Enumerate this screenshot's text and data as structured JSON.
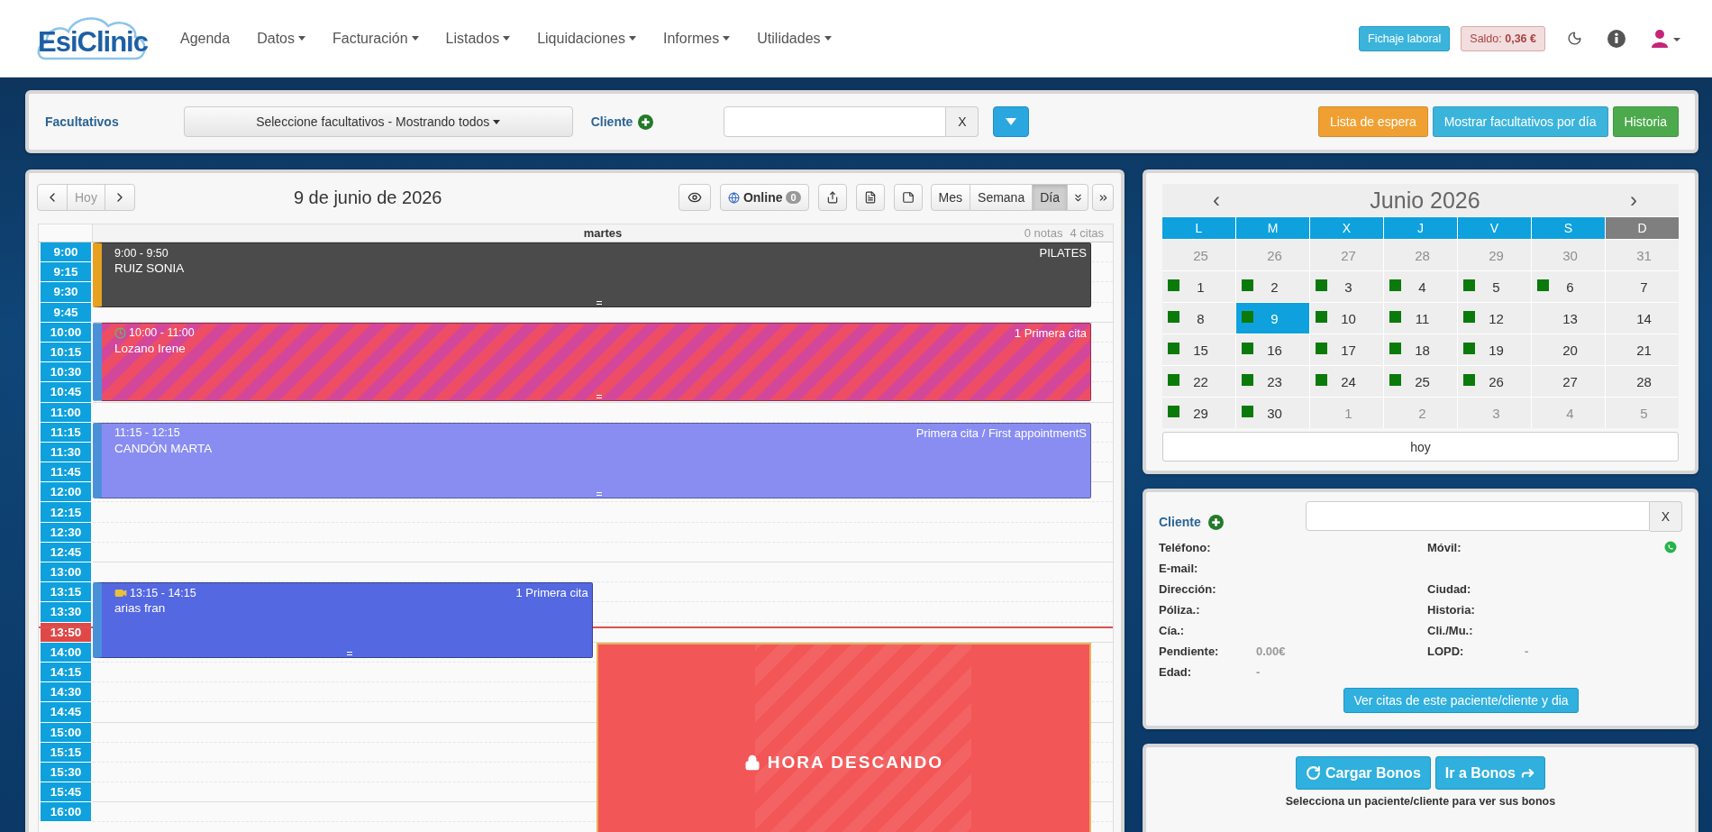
{
  "header": {
    "logo": "EsiClinic",
    "nav": [
      {
        "label": "Agenda",
        "has_menu": false
      },
      {
        "label": "Datos",
        "has_menu": true
      },
      {
        "label": "Facturación",
        "has_menu": true
      },
      {
        "label": "Listados",
        "has_menu": true
      },
      {
        "label": "Liquidaciones",
        "has_menu": true
      },
      {
        "label": "Informes",
        "has_menu": true
      },
      {
        "label": "Utilidades",
        "has_menu": true
      }
    ],
    "clock_in_button": "Fichaje laboral",
    "balance": {
      "label": "Saldo:",
      "amount": "0,36 €"
    }
  },
  "toolbar": {
    "practitioners_label": "Facultativos",
    "practitioners_select": "Seleccione facultativos - Mostrando todos",
    "client_label": "Cliente",
    "clear_button": "X",
    "buttons": [
      {
        "label": "Lista de espera",
        "color": "#f0a032"
      },
      {
        "label": "Mostrar facultativos por día",
        "color": "#3bb4dc"
      },
      {
        "label": "Historia",
        "color": "#4caa4c"
      }
    ]
  },
  "agenda": {
    "today_button": {
      "label": "Hoy",
      "disabled": true
    },
    "date_title": "9 de junio de 2026",
    "online": {
      "label": "Online",
      "count": "0"
    },
    "views": [
      {
        "label": "Mes",
        "selected": false
      },
      {
        "label": "Semana",
        "selected": false
      },
      {
        "label": "Día",
        "selected": true
      }
    ],
    "day_name": "martes",
    "notes": "0 notas",
    "appointments_count": "4 citas",
    "times": [
      {
        "label": "9:00",
        "current": false
      },
      {
        "label": "9:15",
        "current": false
      },
      {
        "label": "9:30",
        "current": false
      },
      {
        "label": "9:45",
        "current": false
      },
      {
        "label": "10:00",
        "current": false
      },
      {
        "label": "10:15",
        "current": false
      },
      {
        "label": "10:30",
        "current": false
      },
      {
        "label": "10:45",
        "current": false
      },
      {
        "label": "11:00",
        "current": false
      },
      {
        "label": "11:15",
        "current": false
      },
      {
        "label": "11:30",
        "current": false
      },
      {
        "label": "11:45",
        "current": false
      },
      {
        "label": "12:00",
        "current": false
      },
      {
        "label": "12:15",
        "current": false
      },
      {
        "label": "12:30",
        "current": false
      },
      {
        "label": "12:45",
        "current": false
      },
      {
        "label": "13:00",
        "current": false
      },
      {
        "label": "13:15",
        "current": false
      },
      {
        "label": "13:30",
        "current": false
      },
      {
        "label": "13:50",
        "current": true
      },
      {
        "label": "14:00",
        "current": false
      },
      {
        "label": "14:15",
        "current": false
      },
      {
        "label": "14:30",
        "current": false
      },
      {
        "label": "14:45",
        "current": false
      },
      {
        "label": "15:00",
        "current": false
      },
      {
        "label": "15:15",
        "current": false
      },
      {
        "label": "15:30",
        "current": false
      },
      {
        "label": "15:45",
        "current": false
      },
      {
        "label": "16:00",
        "current": false
      }
    ],
    "events": [
      {
        "kind": "plain",
        "time": "9:00 - 9:50",
        "name": "RUIZ SONIA",
        "tag": "PILATES",
        "color": "#4b4b4b"
      },
      {
        "kind": "striped",
        "time": "10:00 - 11:00",
        "name": "Lozano Irene",
        "tag": "1 Primera cita",
        "color": "#ee4d66"
      },
      {
        "kind": "plain",
        "time": "11:15 - 12:15",
        "name": "CANDÓN MARTA",
        "tag": "Primera cita / First appointmentS",
        "color": "#898df2"
      },
      {
        "kind": "plain",
        "time": "13:15 - 14:15",
        "name": "arias fran",
        "tag": "1 Primera cita",
        "color": "#5468e2"
      },
      {
        "kind": "blocked",
        "title": "HORA DESCANDO",
        "color": "#f35656"
      }
    ]
  },
  "mini_calendar": {
    "title": "Junio 2026",
    "prev": "‹",
    "next": "›",
    "weekdays": [
      {
        "label": "L",
        "closed": false
      },
      {
        "label": "M",
        "closed": false
      },
      {
        "label": "X",
        "closed": false
      },
      {
        "label": "J",
        "closed": false
      },
      {
        "label": "V",
        "closed": false
      },
      {
        "label": "S",
        "closed": false
      },
      {
        "label": "D",
        "closed": true
      }
    ],
    "weeks": [
      [
        {
          "day": "25",
          "other_month": true,
          "has_appointments": false,
          "selected": false
        },
        {
          "day": "26",
          "other_month": true,
          "has_appointments": false,
          "selected": false
        },
        {
          "day": "27",
          "other_month": true,
          "has_appointments": false,
          "selected": false
        },
        {
          "day": "28",
          "other_month": true,
          "has_appointments": false,
          "selected": false
        },
        {
          "day": "29",
          "other_month": true,
          "has_appointments": false,
          "selected": false
        },
        {
          "day": "30",
          "other_month": true,
          "has_appointments": false,
          "selected": false
        },
        {
          "day": "31",
          "other_month": true,
          "has_appointments": false,
          "selected": false
        }
      ],
      [
        {
          "day": "1",
          "other_month": false,
          "has_appointments": true,
          "selected": false
        },
        {
          "day": "2",
          "other_month": false,
          "has_appointments": true,
          "selected": false
        },
        {
          "day": "3",
          "other_month": false,
          "has_appointments": true,
          "selected": false
        },
        {
          "day": "4",
          "other_month": false,
          "has_appointments": true,
          "selected": false
        },
        {
          "day": "5",
          "other_month": false,
          "has_appointments": true,
          "selected": false
        },
        {
          "day": "6",
          "other_month": false,
          "has_appointments": true,
          "selected": false
        },
        {
          "day": "7",
          "other_month": false,
          "has_appointments": false,
          "selected": false
        }
      ],
      [
        {
          "day": "8",
          "other_month": false,
          "has_appointments": true,
          "selected": false
        },
        {
          "day": "9",
          "other_month": false,
          "has_appointments": true,
          "selected": true
        },
        {
          "day": "10",
          "other_month": false,
          "has_appointments": true,
          "selected": false
        },
        {
          "day": "11",
          "other_month": false,
          "has_appointments": true,
          "selected": false
        },
        {
          "day": "12",
          "other_month": false,
          "has_appointments": true,
          "selected": false
        },
        {
          "day": "13",
          "other_month": false,
          "has_appointments": false,
          "selected": false
        },
        {
          "day": "14",
          "other_month": false,
          "has_appointments": false,
          "selected": false
        }
      ],
      [
        {
          "day": "15",
          "other_month": false,
          "has_appointments": true,
          "selected": false
        },
        {
          "day": "16",
          "other_month": false,
          "has_appointments": true,
          "selected": false
        },
        {
          "day": "17",
          "other_month": false,
          "has_appointments": true,
          "selected": false
        },
        {
          "day": "18",
          "other_month": false,
          "has_appointments": true,
          "selected": false
        },
        {
          "day": "19",
          "other_month": false,
          "has_appointments": true,
          "selected": false
        },
        {
          "day": "20",
          "other_month": false,
          "has_appointments": false,
          "selected": false
        },
        {
          "day": "21",
          "other_month": false,
          "has_appointments": false,
          "selected": false
        }
      ],
      [
        {
          "day": "22",
          "other_month": false,
          "has_appointments": true,
          "selected": false
        },
        {
          "day": "23",
          "other_month": false,
          "has_appointments": true,
          "selected": false
        },
        {
          "day": "24",
          "other_month": false,
          "has_appointments": true,
          "selected": false
        },
        {
          "day": "25",
          "other_month": false,
          "has_appointments": true,
          "selected": false
        },
        {
          "day": "26",
          "other_month": false,
          "has_appointments": true,
          "selected": false
        },
        {
          "day": "27",
          "other_month": false,
          "has_appointments": false,
          "selected": false
        },
        {
          "day": "28",
          "other_month": false,
          "has_appointments": false,
          "selected": false
        }
      ],
      [
        {
          "day": "29",
          "other_month": false,
          "has_appointments": true,
          "selected": false
        },
        {
          "day": "30",
          "other_month": false,
          "has_appointments": true,
          "selected": false
        },
        {
          "day": "1",
          "other_month": true,
          "has_appointments": false,
          "selected": false
        },
        {
          "day": "2",
          "other_month": true,
          "has_appointments": false,
          "selected": false
        },
        {
          "day": "3",
          "other_month": true,
          "has_appointments": false,
          "selected": false
        },
        {
          "day": "4",
          "other_month": true,
          "has_appointments": false,
          "selected": false
        },
        {
          "day": "5",
          "other_month": true,
          "has_appointments": false,
          "selected": false
        }
      ]
    ],
    "today_button": "hoy"
  },
  "client_panel": {
    "label": "Cliente",
    "clear_button": "X",
    "rows": [
      {
        "left": {
          "label": "Teléfono:"
        },
        "right": {
          "label": "Móvil:",
          "kind": "mobile"
        }
      },
      {
        "left": {
          "label": "E-mail:"
        }
      },
      {
        "left": {
          "label": "Dirección:"
        },
        "right": {
          "label": "Ciudad:"
        }
      },
      {
        "left": {
          "label": "Póliza.:"
        },
        "right": {
          "label": "Historia:"
        }
      },
      {
        "left": {
          "label": "Cía.:"
        },
        "right": {
          "label": "Cli./Mu.:"
        }
      },
      {
        "left": {
          "label": "Pendiente:",
          "value": "0.00€"
        },
        "right": {
          "label": "LOPD:",
          "value": "-"
        }
      },
      {
        "left": {
          "label": "Edad:",
          "value": "-"
        }
      }
    ],
    "appointments_button": "Ver citas de este paciente/cliente y dia"
  },
  "bonos": {
    "load_button": "Cargar Bonos",
    "go_button": "Ir a Bonos",
    "hint": "Selecciona un paciente/cliente para ver sus bonos"
  }
}
